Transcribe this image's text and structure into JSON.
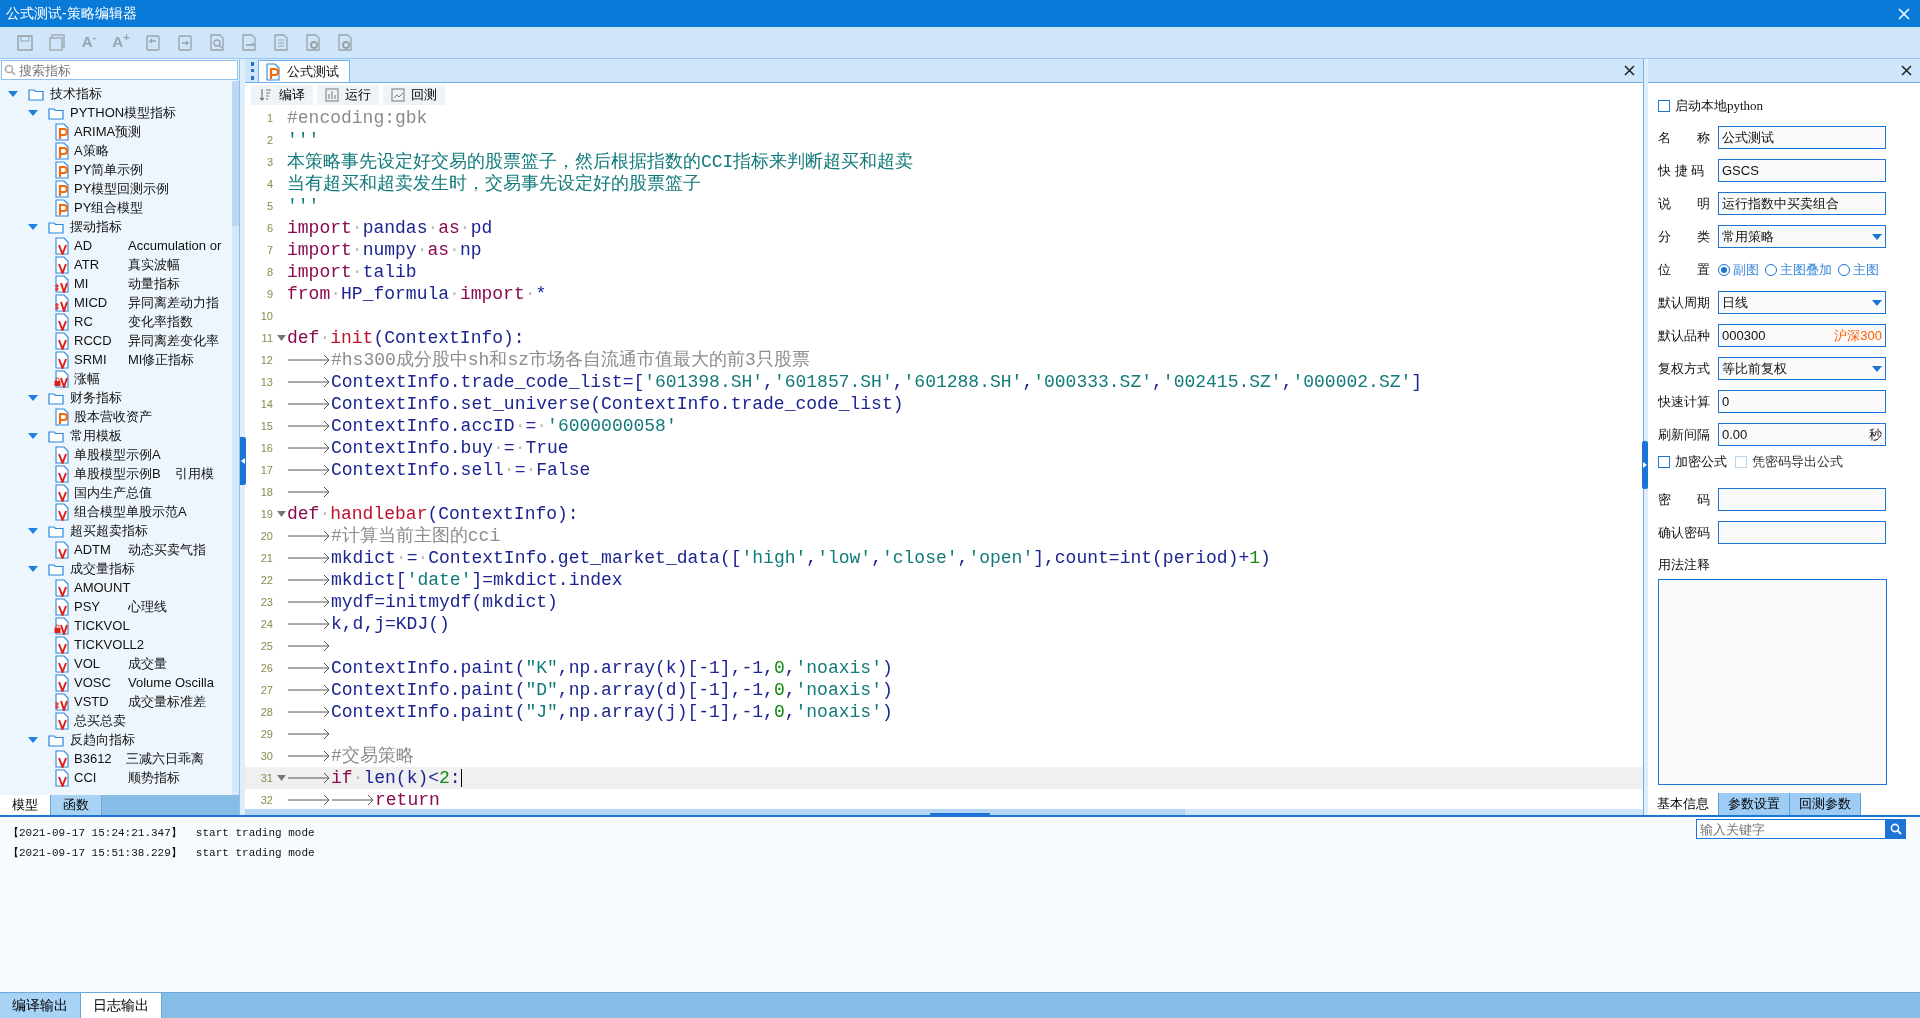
{
  "window": {
    "title": "公式测试-策略编辑器"
  },
  "toolbar": [
    {
      "kind": "save"
    },
    {
      "kind": "save_all"
    },
    {
      "kind": "glyph",
      "text": "A$^{-}$"
    },
    {
      "kind": "glyph",
      "text": "A$^{+}$"
    },
    {
      "kind": "undo"
    },
    {
      "kind": "redo"
    },
    {
      "kind": "find"
    },
    {
      "kind": "export"
    },
    {
      "kind": "document"
    },
    {
      "kind": "config"
    },
    {
      "kind": "config"
    }
  ],
  "sidebar": {
    "search": {
      "placeholder": "搜索指标"
    },
    "tree": [
      {
        "label": "技术指标",
        "expanded": true,
        "children": [
          {
            "label": "PYTHON模型指标",
            "expanded": true,
            "children": [
              {
                "kind": "python",
                "label": "ARIMA预测"
              },
              {
                "kind": "python",
                "label": "A策略"
              },
              {
                "kind": "python",
                "label": "PY简单示例"
              },
              {
                "kind": "python",
                "label": "PY模型回测示例"
              },
              {
                "kind": "python",
                "label": "PY组合模型"
              }
            ]
          },
          {
            "label": "摆动指标",
            "expanded": true,
            "children": [
              {
                "kind": "formula",
                "label": "AD",
                "desc": "Accumulation or"
              },
              {
                "kind": "formula",
                "label": "ATR",
                "desc": "真实波幅"
              },
              {
                "kind": "encrypted",
                "label": "MI",
                "desc": "动量指标"
              },
              {
                "kind": "encrypted",
                "label": "MICD",
                "desc": "异同离差动力指"
              },
              {
                "kind": "formula",
                "label": "RC",
                "desc": "变化率指数"
              },
              {
                "kind": "formula",
                "label": "RCCD",
                "desc": "异同离差变化率"
              },
              {
                "kind": "formula",
                "label": "SRMI",
                "desc": "MI修正指标"
              },
              {
                "kind": "locked",
                "label": "涨幅"
              }
            ]
          },
          {
            "label": "财务指标",
            "expanded": true,
            "children": [
              {
                "kind": "python",
                "label": "股本营收资产"
              }
            ]
          },
          {
            "label": "常用模板",
            "expanded": true,
            "children": [
              {
                "kind": "formula",
                "label": "单股模型示例A"
              },
              {
                "kind": "formula",
                "label": "单股模型示例B",
                "desc": "引用模"
              },
              {
                "kind": "formula",
                "label": "国内生产总值"
              },
              {
                "kind": "formula",
                "label": "组合模型单股示范A"
              }
            ]
          },
          {
            "label": "超买超卖指标",
            "expanded": true,
            "children": [
              {
                "kind": "formula",
                "label": "ADTM",
                "desc": "动态买卖气指"
              }
            ]
          },
          {
            "label": "成交量指标",
            "expanded": true,
            "children": [
              {
                "kind": "formula",
                "label": "AMOUNT"
              },
              {
                "kind": "formula",
                "label": "PSY",
                "desc": "心理线"
              },
              {
                "kind": "locked",
                "label": "TICKVOL"
              },
              {
                "kind": "formula",
                "label": "TICKVOLL2"
              },
              {
                "kind": "formula",
                "label": "VOL",
                "desc": "成交量"
              },
              {
                "kind": "formula",
                "label": "VOSC",
                "desc": "Volume Oscilla"
              },
              {
                "kind": "encrypted",
                "label": "VSTD",
                "desc": "成交量标准差"
              },
              {
                "kind": "formula",
                "label": "总买总卖"
              }
            ]
          },
          {
            "label": "反趋向指标",
            "expanded": true,
            "children": [
              {
                "kind": "formula",
                "label": "B3612",
                "desc": "三减六日乖离"
              },
              {
                "kind": "formula",
                "label": "CCI",
                "desc": "顺势指标"
              }
            ]
          }
        ]
      }
    ],
    "tabs": [
      {
        "label": "模型",
        "selected": true
      },
      {
        "label": "函数",
        "selected": false
      }
    ]
  },
  "editor": {
    "tabs": [
      {
        "label": "公式测试",
        "selected": true
      }
    ],
    "commands": [
      {
        "kind": "compile",
        "label": "编译"
      },
      {
        "kind": "run",
        "label": "运行"
      },
      {
        "kind": "backtest",
        "label": "回测"
      }
    ],
    "lines": [
      {
        "n": "1",
        "fold": false,
        "current": false,
        "tokens": [
          {
            "kind": "cmt",
            "text": "#encoding:gbk"
          }
        ]
      },
      {
        "n": "2",
        "fold": false,
        "current": false,
        "tokens": [
          {
            "kind": "str",
            "text": "'''"
          }
        ]
      },
      {
        "n": "3",
        "fold": false,
        "current": false,
        "tokens": [
          {
            "kind": "str",
            "text": "本策略事先设定好交易的股票篮子，然后根据指数的CCI指标来判断超买和超卖"
          }
        ]
      },
      {
        "n": "4",
        "fold": false,
        "current": false,
        "tokens": [
          {
            "kind": "str",
            "text": "当有超买和超卖发生时，交易事先设定好的股票篮子"
          }
        ]
      },
      {
        "n": "5",
        "fold": false,
        "current": false,
        "tokens": [
          {
            "kind": "str",
            "text": "'''"
          }
        ]
      },
      {
        "n": "6",
        "fold": false,
        "current": false,
        "tokens": [
          {
            "kind": "kw",
            "text": "import"
          },
          {
            "kind": "ws",
            "text": "·"
          },
          {
            "kind": "id",
            "text": "pandas"
          },
          {
            "kind": "ws",
            "text": "·"
          },
          {
            "kind": "kw",
            "text": "as"
          },
          {
            "kind": "ws",
            "text": "·"
          },
          {
            "kind": "id",
            "text": "pd"
          }
        ]
      },
      {
        "n": "7",
        "fold": false,
        "current": false,
        "tokens": [
          {
            "kind": "kw",
            "text": "import"
          },
          {
            "kind": "ws",
            "text": "·"
          },
          {
            "kind": "id",
            "text": "numpy"
          },
          {
            "kind": "ws",
            "text": "·"
          },
          {
            "kind": "kw",
            "text": "as"
          },
          {
            "kind": "ws",
            "text": "·"
          },
          {
            "kind": "id",
            "text": "np"
          }
        ]
      },
      {
        "n": "8",
        "fold": false,
        "current": false,
        "tokens": [
          {
            "kind": "kw",
            "text": "import"
          },
          {
            "kind": "ws",
            "text": "·"
          },
          {
            "kind": "id",
            "text": "talib"
          }
        ]
      },
      {
        "n": "9",
        "fold": false,
        "current": false,
        "tokens": [
          {
            "kind": "kw",
            "text": "from"
          },
          {
            "kind": "ws",
            "text": "·"
          },
          {
            "kind": "id",
            "text": "HP_formula"
          },
          {
            "kind": "ws",
            "text": "·"
          },
          {
            "kind": "kw",
            "text": "import"
          },
          {
            "kind": "ws",
            "text": "·"
          },
          {
            "kind": "id",
            "text": "*"
          }
        ]
      },
      {
        "n": "10",
        "fold": false,
        "current": false
      },
      {
        "n": "11",
        "fold": true,
        "current": false,
        "tokens": [
          {
            "kind": "kw",
            "text": "def"
          },
          {
            "kind": "ws",
            "text": "·"
          },
          {
            "kind": "fn",
            "text": "init"
          },
          {
            "kind": "id",
            "text": "(ContextInfo):"
          }
        ]
      },
      {
        "n": "12",
        "fold": false,
        "current": false,
        "tokens": [
          {
            "kind": "tab"
          },
          {
            "kind": "cmt",
            "text": "#hs300成分股中sh和sz市场各自流通市值最大的前3只股票"
          }
        ]
      },
      {
        "n": "13",
        "fold": false,
        "current": false,
        "tokens": [
          {
            "kind": "tab"
          },
          {
            "kind": "id",
            "text": "ContextInfo.trade_code_list=["
          },
          {
            "kind": "str",
            "text": "'601398.SH'"
          },
          {
            "kind": "id",
            "text": ","
          },
          {
            "kind": "str",
            "text": "'601857.SH'"
          },
          {
            "kind": "id",
            "text": ","
          },
          {
            "kind": "str",
            "text": "'601288.SH'"
          },
          {
            "kind": "id",
            "text": ","
          },
          {
            "kind": "str",
            "text": "'000333.SZ'"
          },
          {
            "kind": "id",
            "text": ","
          },
          {
            "kind": "str",
            "text": "'002415.SZ'"
          },
          {
            "kind": "id",
            "text": ","
          },
          {
            "kind": "str",
            "text": "'000002.SZ'"
          },
          {
            "kind": "id",
            "text": "]"
          }
        ]
      },
      {
        "n": "14",
        "fold": false,
        "current": false,
        "tokens": [
          {
            "kind": "tab"
          },
          {
            "kind": "id",
            "text": "ContextInfo.set_universe(ContextInfo.trade_code_list)"
          }
        ]
      },
      {
        "n": "15",
        "fold": false,
        "current": false,
        "tokens": [
          {
            "kind": "tab"
          },
          {
            "kind": "id",
            "text": "ContextInfo.accID"
          },
          {
            "kind": "ws",
            "text": "·"
          },
          {
            "kind": "id",
            "text": "="
          },
          {
            "kind": "ws",
            "text": "·"
          },
          {
            "kind": "str",
            "text": "'6000000058'"
          }
        ]
      },
      {
        "n": "16",
        "fold": false,
        "current": false,
        "tokens": [
          {
            "kind": "tab"
          },
          {
            "kind": "id",
            "text": "ContextInfo.buy"
          },
          {
            "kind": "ws",
            "text": "·"
          },
          {
            "kind": "id",
            "text": "="
          },
          {
            "kind": "ws",
            "text": "·"
          },
          {
            "kind": "id",
            "text": "True"
          }
        ]
      },
      {
        "n": "17",
        "fold": false,
        "current": false,
        "tokens": [
          {
            "kind": "tab"
          },
          {
            "kind": "id",
            "text": "ContextInfo.sell"
          },
          {
            "kind": "ws",
            "text": "·"
          },
          {
            "kind": "id",
            "text": "="
          },
          {
            "kind": "ws",
            "text": "·"
          },
          {
            "kind": "id",
            "text": "False"
          }
        ]
      },
      {
        "n": "18",
        "fold": false,
        "current": false,
        "tokens": [
          {
            "kind": "tab"
          }
        ]
      },
      {
        "n": "19",
        "fold": true,
        "current": false,
        "tokens": [
          {
            "kind": "kw",
            "text": "def"
          },
          {
            "kind": "ws",
            "text": "·"
          },
          {
            "kind": "fn",
            "text": "handlebar"
          },
          {
            "kind": "id",
            "text": "(ContextInfo):"
          }
        ]
      },
      {
        "n": "20",
        "fold": false,
        "current": false,
        "tokens": [
          {
            "kind": "tab"
          },
          {
            "kind": "cmt",
            "text": "#计算当前主图的cci"
          }
        ]
      },
      {
        "n": "21",
        "fold": false,
        "current": false,
        "tokens": [
          {
            "kind": "tab"
          },
          {
            "kind": "id",
            "text": "mkdict"
          },
          {
            "kind": "ws",
            "text": "·"
          },
          {
            "kind": "id",
            "text": "="
          },
          {
            "kind": "ws",
            "text": "·"
          },
          {
            "kind": "id",
            "text": "ContextInfo.get_market_data(["
          },
          {
            "kind": "str",
            "text": "'high'"
          },
          {
            "kind": "id",
            "text": ","
          },
          {
            "kind": "str",
            "text": "'low'"
          },
          {
            "kind": "id",
            "text": ","
          },
          {
            "kind": "str",
            "text": "'close'"
          },
          {
            "kind": "id",
            "text": ","
          },
          {
            "kind": "str",
            "text": "'open'"
          },
          {
            "kind": "id",
            "text": "],count=int(period)+"
          },
          {
            "kind": "num",
            "text": "1"
          },
          {
            "kind": "id",
            "text": ")"
          }
        ]
      },
      {
        "n": "22",
        "fold": false,
        "current": false,
        "tokens": [
          {
            "kind": "tab"
          },
          {
            "kind": "id",
            "text": "mkdict["
          },
          {
            "kind": "str",
            "text": "'date'"
          },
          {
            "kind": "id",
            "text": "]=mkdict.index"
          }
        ]
      },
      {
        "n": "23",
        "fold": false,
        "current": false,
        "tokens": [
          {
            "kind": "tab"
          },
          {
            "kind": "id",
            "text": "mydf=initmydf(mkdict)"
          }
        ]
      },
      {
        "n": "24",
        "fold": false,
        "current": false,
        "tokens": [
          {
            "kind": "tab"
          },
          {
            "kind": "id",
            "text": "k,d,j=KDJ()"
          }
        ]
      },
      {
        "n": "25",
        "fold": false,
        "current": false,
        "tokens": [
          {
            "kind": "tab"
          }
        ]
      },
      {
        "n": "26",
        "fold": false,
        "current": false,
        "tokens": [
          {
            "kind": "tab"
          },
          {
            "kind": "id",
            "text": "ContextInfo.paint("
          },
          {
            "kind": "str",
            "text": "\"K\""
          },
          {
            "kind": "id",
            "text": ",np.array(k)[-1],-1,"
          },
          {
            "kind": "num",
            "text": "0"
          },
          {
            "kind": "id",
            "text": ","
          },
          {
            "kind": "str",
            "text": "'noaxis'"
          },
          {
            "kind": "id",
            "text": ")"
          }
        ]
      },
      {
        "n": "27",
        "fold": false,
        "current": false,
        "tokens": [
          {
            "kind": "tab"
          },
          {
            "kind": "id",
            "text": "ContextInfo.paint("
          },
          {
            "kind": "str",
            "text": "\"D\""
          },
          {
            "kind": "id",
            "text": ",np.array(d)[-1],-1,"
          },
          {
            "kind": "num",
            "text": "0"
          },
          {
            "kind": "id",
            "text": ","
          },
          {
            "kind": "str",
            "text": "'noaxis'"
          },
          {
            "kind": "id",
            "text": ")"
          }
        ]
      },
      {
        "n": "28",
        "fold": false,
        "current": false,
        "tokens": [
          {
            "kind": "tab"
          },
          {
            "kind": "id",
            "text": "ContextInfo.paint("
          },
          {
            "kind": "str",
            "text": "\"J\""
          },
          {
            "kind": "id",
            "text": ",np.array(j)[-1],-1,"
          },
          {
            "kind": "num",
            "text": "0"
          },
          {
            "kind": "id",
            "text": ","
          },
          {
            "kind": "str",
            "text": "'noaxis'"
          },
          {
            "kind": "id",
            "text": ")"
          }
        ]
      },
      {
        "n": "29",
        "fold": false,
        "current": false,
        "tokens": [
          {
            "kind": "tab"
          }
        ]
      },
      {
        "n": "30",
        "fold": false,
        "current": false,
        "tokens": [
          {
            "kind": "tab"
          },
          {
            "kind": "cmt",
            "text": "#交易策略"
          }
        ]
      },
      {
        "n": "31",
        "fold": true,
        "current": true,
        "tokens": [
          {
            "kind": "tab"
          },
          {
            "kind": "kw",
            "text": "if"
          },
          {
            "kind": "ws",
            "text": "·"
          },
          {
            "kind": "id",
            "text": "len(k)<"
          },
          {
            "kind": "num",
            "text": "2"
          },
          {
            "kind": "id",
            "text": ":"
          }
        ]
      },
      {
        "n": "32",
        "fold": false,
        "current": false,
        "tokens": [
          {
            "kind": "tab"
          },
          {
            "kind": "tab"
          },
          {
            "kind": "kw",
            "text": "return"
          }
        ]
      }
    ]
  },
  "properties": {
    "local_python": {
      "label": "启动本地python",
      "checked": false
    },
    "fields": [
      {
        "kind": "text",
        "label": "名　　称",
        "value": "公式测试"
      },
      {
        "kind": "text",
        "label": "快 捷 码",
        "value": "GSCS"
      },
      {
        "kind": "text",
        "label": "说　　明",
        "value": "运行指数中买卖组合"
      },
      {
        "kind": "select",
        "label": "分　　类",
        "value": "常用策略"
      },
      {
        "kind": "radio",
        "label": "位　　置",
        "options": [
          {
            "label": "副图",
            "selected": true
          },
          {
            "label": "主图叠加",
            "selected": false
          },
          {
            "label": "主图",
            "selected": false
          }
        ]
      },
      {
        "kind": "select",
        "label": "默认周期",
        "value": "日线"
      },
      {
        "kind": "symbol",
        "label": "默认品种",
        "value": "000300",
        "suffix": "沪深300"
      },
      {
        "kind": "select",
        "label": "复权方式",
        "value": "等比前复权"
      },
      {
        "kind": "text",
        "label": "快速计算",
        "value": "0"
      },
      {
        "kind": "unit",
        "label": "刷新间隔",
        "value": "0.00",
        "suffix": "秒"
      }
    ],
    "options": [
      {
        "label": "加密公式",
        "checked": false,
        "disabled": false
      },
      {
        "label": "凭密码导出公式",
        "checked": false,
        "disabled": true
      }
    ],
    "passwords": [
      {
        "label": "密　　码"
      },
      {
        "label": "确认密码"
      }
    ],
    "notes": {
      "label": "用法注释"
    },
    "tabs": [
      {
        "label": "基本信息",
        "selected": true
      },
      {
        "label": "参数设置",
        "selected": false
      },
      {
        "label": "回测参数",
        "selected": false
      }
    ]
  },
  "log": {
    "entries": [
      {
        "time": "【2021-09-17 15:24:21.347】",
        "message": "start trading mode"
      },
      {
        "time": "【2021-09-17 15:51:38.229】",
        "message": "start trading mode"
      }
    ],
    "search": {
      "placeholder": "输入关键字"
    },
    "tabs": [
      {
        "label": "编译输出",
        "selected": false
      },
      {
        "label": "日志输出",
        "selected": true
      }
    ]
  }
}
